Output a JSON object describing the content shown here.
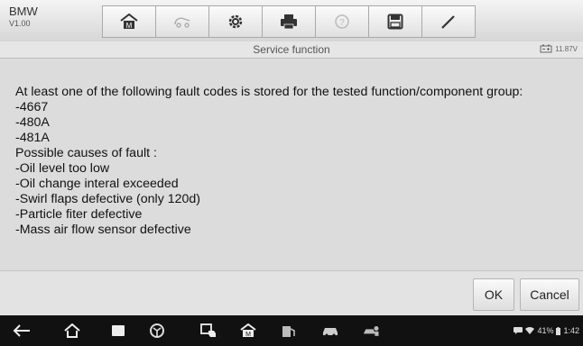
{
  "header": {
    "brand": "BMW",
    "version": "V1.00",
    "tools": [
      "home-icon",
      "vehicle-swap-icon",
      "settings-icon",
      "print-icon",
      "help-icon",
      "save-icon",
      "edit-icon"
    ]
  },
  "titlebar": {
    "title": "Service function",
    "battery_voltage": "11.87V"
  },
  "message": {
    "intro": "At least one of the following fault codes is stored for the tested function/component group:",
    "codes": [
      "-4667",
      "-480A",
      "-481A"
    ],
    "causes_heading": "Possible causes of fault :",
    "causes": [
      "-Oil level too low",
      "-Oil change interal exceeded",
      "-Swirl flaps defective (only 120d)",
      "-Particle fiter defective",
      "-Mass air flow sensor defective"
    ]
  },
  "actions": {
    "ok": "OK",
    "cancel": "Cancel"
  },
  "system_bar": {
    "nav_icons": [
      "back-icon",
      "home-icon",
      "recents-icon",
      "browser-icon",
      "remote-support-icon",
      "vehicle-menu-icon",
      "fuel-icon",
      "car-icon",
      "mechanic-icon"
    ],
    "battery_percent": "41%",
    "time": "1:42"
  }
}
